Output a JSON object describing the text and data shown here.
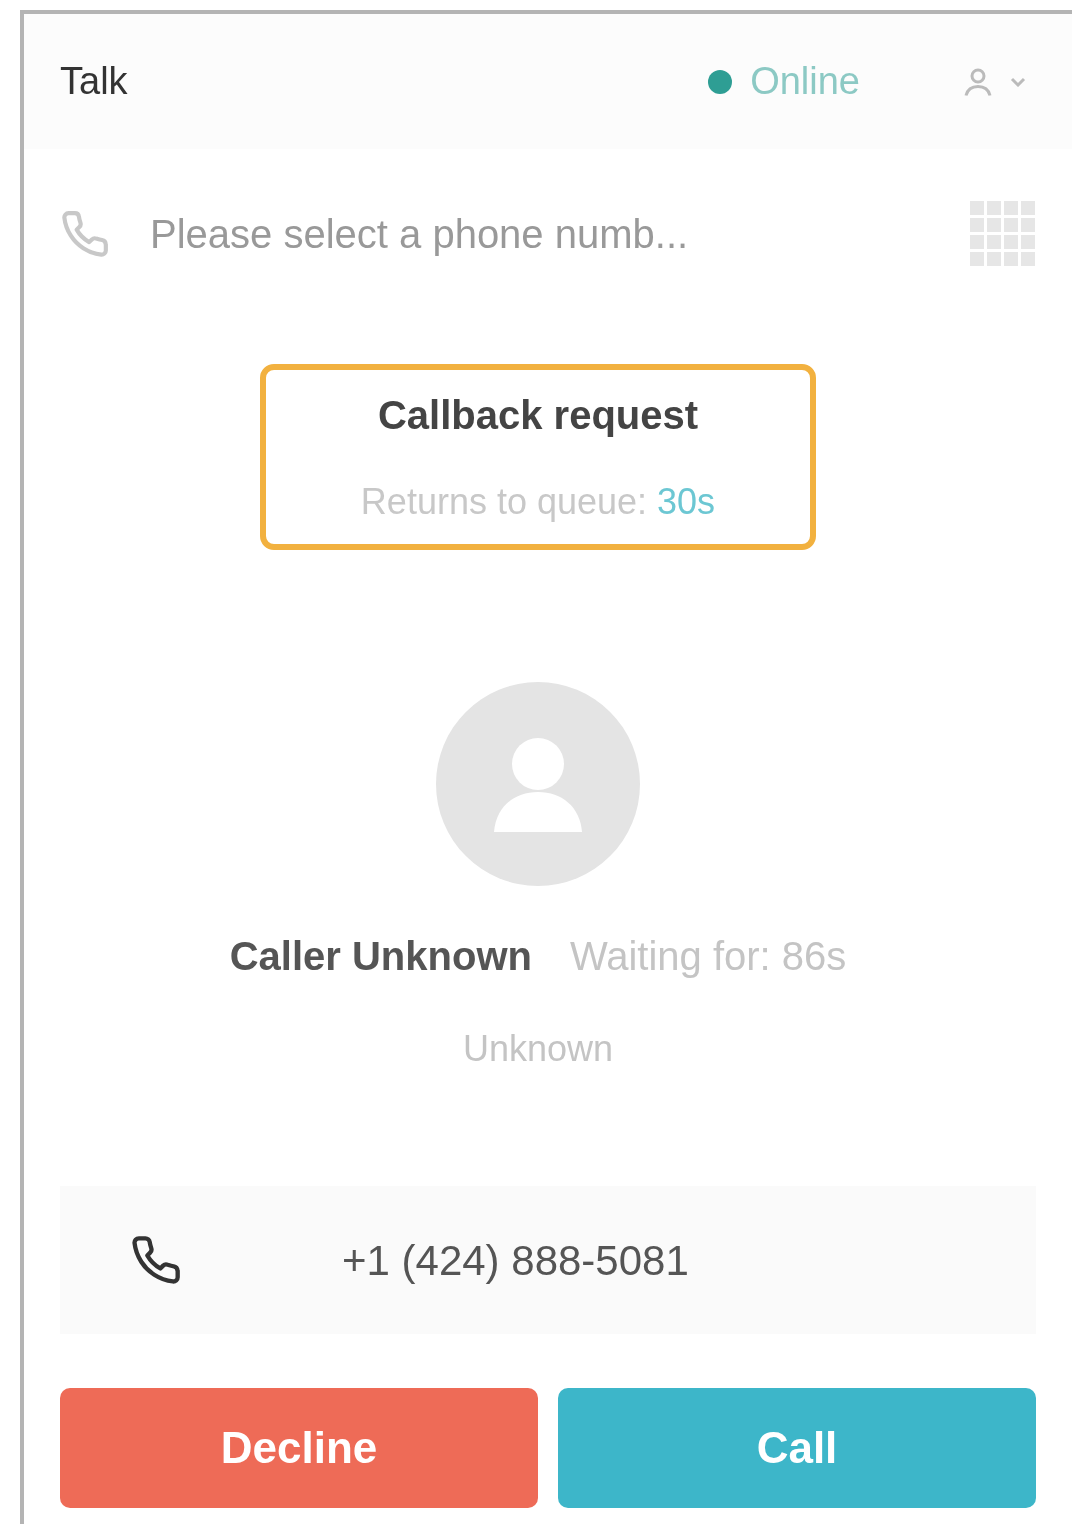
{
  "header": {
    "title": "Talk",
    "status": {
      "label": "Online",
      "color": "#2e9e94"
    }
  },
  "phone_select": {
    "placeholder": "Please select a phone numb..."
  },
  "callback": {
    "title": "Callback request",
    "subtitle": "Returns to queue:",
    "timer": "30s"
  },
  "caller": {
    "name": "Caller Unknown",
    "waiting": "Waiting for: 86s",
    "location": "Unknown"
  },
  "incoming_number": "+1 (424) 888-5081",
  "buttons": [
    {
      "label": "Decline",
      "kind": "decline"
    },
    {
      "label": "Call",
      "kind": "call"
    }
  ]
}
